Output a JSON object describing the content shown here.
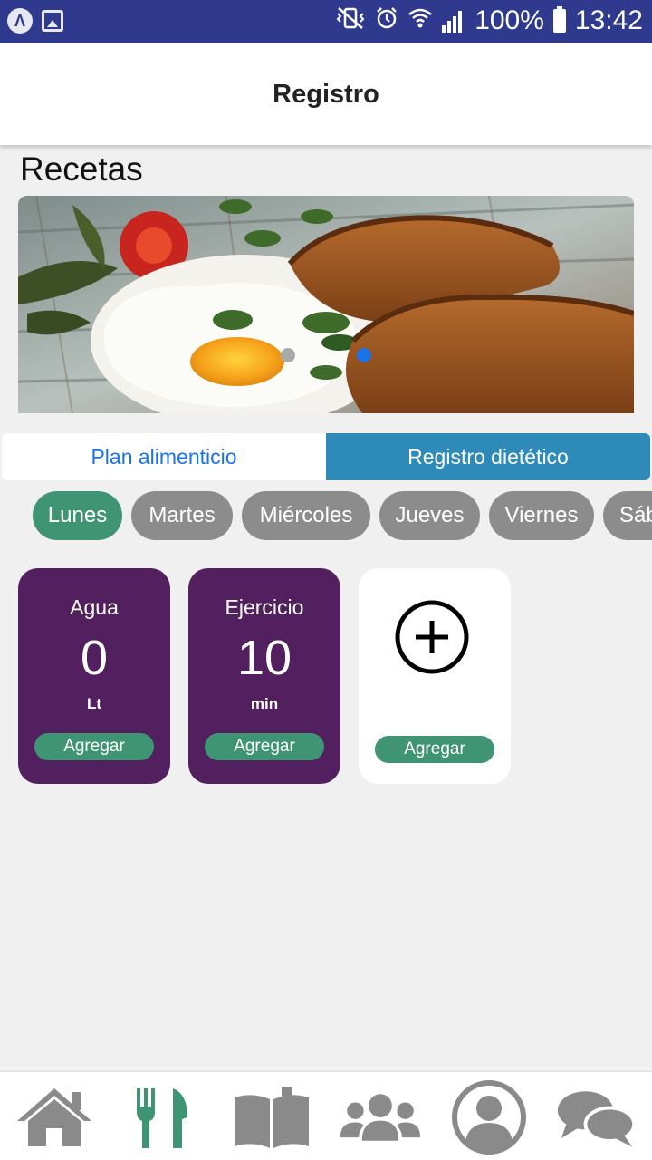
{
  "status_bar": {
    "battery": "100%",
    "time": "13:42",
    "left_icons": [
      "app-a-icon",
      "image-icon"
    ],
    "right_icons": [
      "vibrate-mute-icon",
      "alarm-icon",
      "wifi-icon",
      "signal-icon",
      "battery-icon"
    ]
  },
  "header": {
    "title": "Registro"
  },
  "section": {
    "title": "Recetas"
  },
  "banner": {
    "image": "fried-egg-and-toast-photo",
    "pages": 2,
    "active_page": 2
  },
  "tabs": [
    {
      "label": "Plan alimenticio",
      "selected": false
    },
    {
      "label": "Registro dietético",
      "selected": true
    }
  ],
  "days": [
    {
      "label": "Lunes",
      "selected": true
    },
    {
      "label": "Martes",
      "selected": false
    },
    {
      "label": "Miércoles",
      "selected": false
    },
    {
      "label": "Jueves",
      "selected": false
    },
    {
      "label": "Viernes",
      "selected": false
    },
    {
      "label": "Sáb",
      "selected": false
    }
  ],
  "cards": [
    {
      "label": "Agua",
      "value": "0",
      "unit": "Lt",
      "button": "Agregar"
    },
    {
      "label": "Ejercicio",
      "value": "10",
      "unit": "min",
      "button": "Agregar"
    },
    {
      "button": "Agregar",
      "icon": "plus-circle-icon"
    }
  ],
  "bottom_nav": [
    {
      "icon": "home-icon",
      "active": false
    },
    {
      "icon": "fork-knife-icon",
      "active": true
    },
    {
      "icon": "book-icon",
      "active": false
    },
    {
      "icon": "group-icon",
      "active": false
    },
    {
      "icon": "profile-icon",
      "active": false
    },
    {
      "icon": "chat-icon",
      "active": false
    }
  ],
  "colors": {
    "status_bar": "#2f3a8f",
    "accent_green": "#3e9473",
    "card_purple": "#53205f",
    "tab_blue": "#2e8ab8",
    "link_blue": "#1a73e8",
    "chip_gray": "#8c8c8c",
    "icon_gray": "#8a8a8a"
  }
}
